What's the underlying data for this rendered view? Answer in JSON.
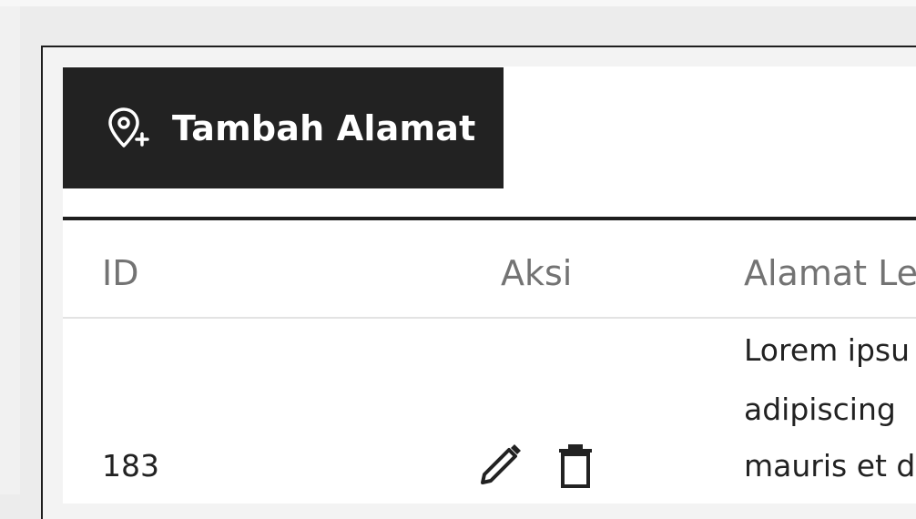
{
  "toolbar": {
    "add_button_label": "Tambah Alamat",
    "add_icon": "location-add-icon"
  },
  "table": {
    "columns": [
      "ID",
      "Aksi",
      "Alamat Le"
    ],
    "rows": [
      {
        "id": "183",
        "actions": [
          "edit-icon",
          "delete-icon"
        ],
        "address_lines": [
          "Lorem ipsu",
          "adipiscing",
          "mauris et d"
        ]
      }
    ]
  },
  "colors": {
    "button_bg": "#222222",
    "button_text": "#ffffff",
    "header_text": "#737373",
    "body_text": "#222222",
    "rule": "#1e1e1e",
    "divider": "#e3e3e3",
    "page_bg": "#ececec"
  }
}
